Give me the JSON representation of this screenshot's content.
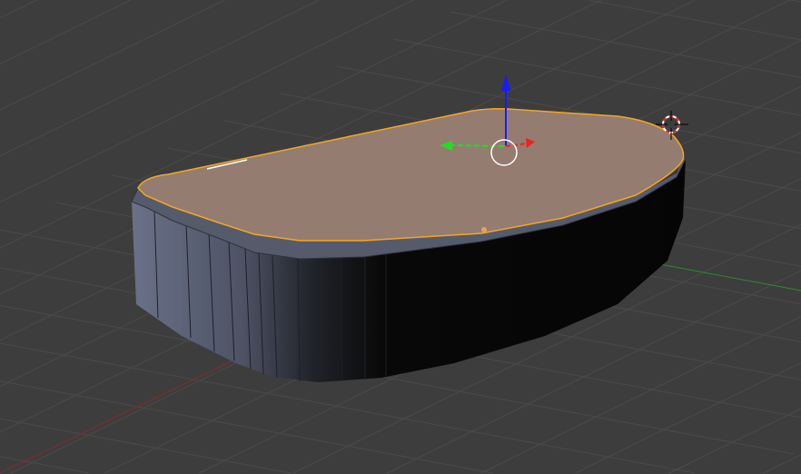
{
  "viewport": {
    "background_color": "#3d3d3d",
    "grid_color": "#4b4b4b",
    "x_axis_color": "#8a2a2a",
    "y_axis_color": "#2f8a2f"
  },
  "object": {
    "top_face_color": "#957c70",
    "selection_outline_color": "#f5a623",
    "side_light_color": "#6a7189",
    "side_dark_color": "#050505",
    "origin_dot_color": "#e8a060"
  },
  "gizmo": {
    "z_color": "#1a1aff",
    "y_color": "#22dd22",
    "x_color": "#ee2222",
    "ring_color": "#ffffff"
  },
  "icons": [
    "transform-gizmo-icon",
    "3d-cursor-icon",
    "object-origin-icon"
  ]
}
